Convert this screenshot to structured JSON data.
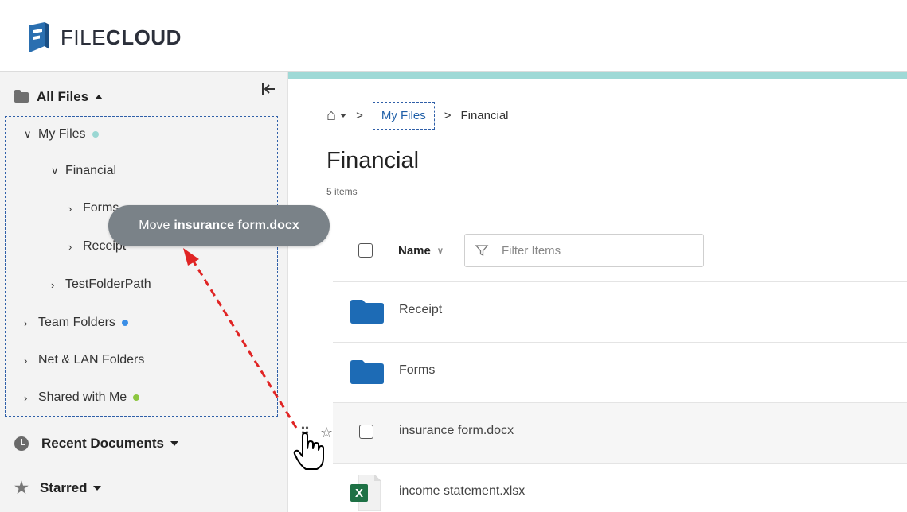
{
  "app": {
    "logo_light": "FILE",
    "logo_bold": "CLOUD"
  },
  "sidebar": {
    "all_files_label": "All Files",
    "tree": [
      {
        "label": "My Files",
        "chevron": "v",
        "dot_color": "#9ad7d3"
      },
      {
        "label": "Financial",
        "chevron": "v"
      },
      {
        "label": "Forms",
        "chevron": ">"
      },
      {
        "label": "Receipt",
        "chevron": ">"
      },
      {
        "label": "TestFolderPath",
        "chevron": ">"
      },
      {
        "label": "Team Folders",
        "chevron": ">",
        "dot_color": "#3a8ee6"
      },
      {
        "label": "Net & LAN Folders",
        "chevron": ">"
      },
      {
        "label": "Shared with Me",
        "chevron": ">",
        "dot_color": "#8cc63f"
      }
    ],
    "recent_label": "Recent Documents",
    "starred_label": "Starred"
  },
  "breadcrumb": {
    "items": [
      "My Files",
      "Financial"
    ],
    "separator": ">"
  },
  "main": {
    "title": "Financial",
    "item_count": "5 items",
    "name_column": "Name",
    "filter_placeholder": "Filter Items",
    "rows": [
      {
        "name": "Receipt",
        "type": "folder"
      },
      {
        "name": "Forms",
        "type": "folder"
      },
      {
        "name": "insurance form.docx",
        "type": "docx"
      },
      {
        "name": "income statement.xlsx",
        "type": "xlsx"
      }
    ]
  },
  "drag_tooltip": {
    "prefix": "Move",
    "file": "insurance form.docx"
  },
  "colors": {
    "accent_teal": "#9fd9d6",
    "folder_blue": "#1d6bb5",
    "drag_arrow": "#e02424",
    "excel_green": "#1e7145"
  }
}
